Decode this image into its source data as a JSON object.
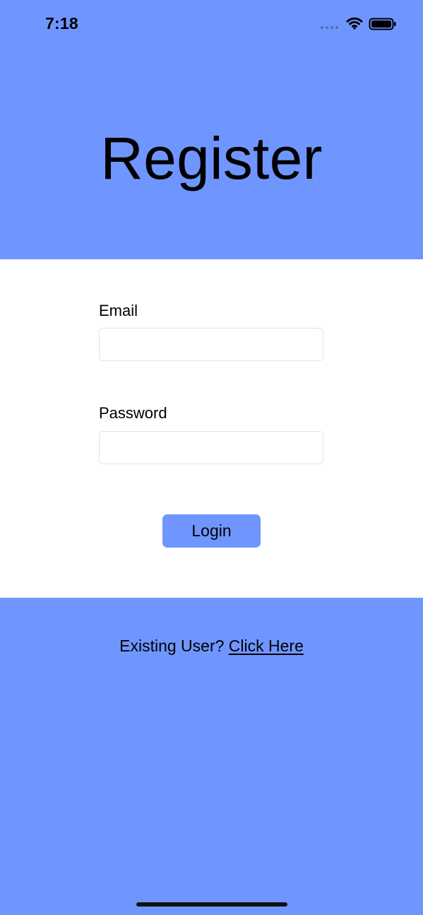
{
  "status_bar": {
    "time": "7:18",
    "icons": [
      "signal-dots-icon",
      "wifi-icon",
      "battery-icon"
    ]
  },
  "header": {
    "title": "Register"
  },
  "form": {
    "email_label": "Email",
    "email_value": "",
    "email_placeholder": "",
    "password_label": "Password",
    "password_value": "",
    "password_placeholder": "",
    "login_button": "Login"
  },
  "footer": {
    "existing_user_text": "Existing User?",
    "link_text": "Click Here"
  },
  "colors": {
    "accent_background": "#6f96ff",
    "panel_background": "#ffffff",
    "field_border": "#e3e3e6",
    "text": "#000000"
  }
}
